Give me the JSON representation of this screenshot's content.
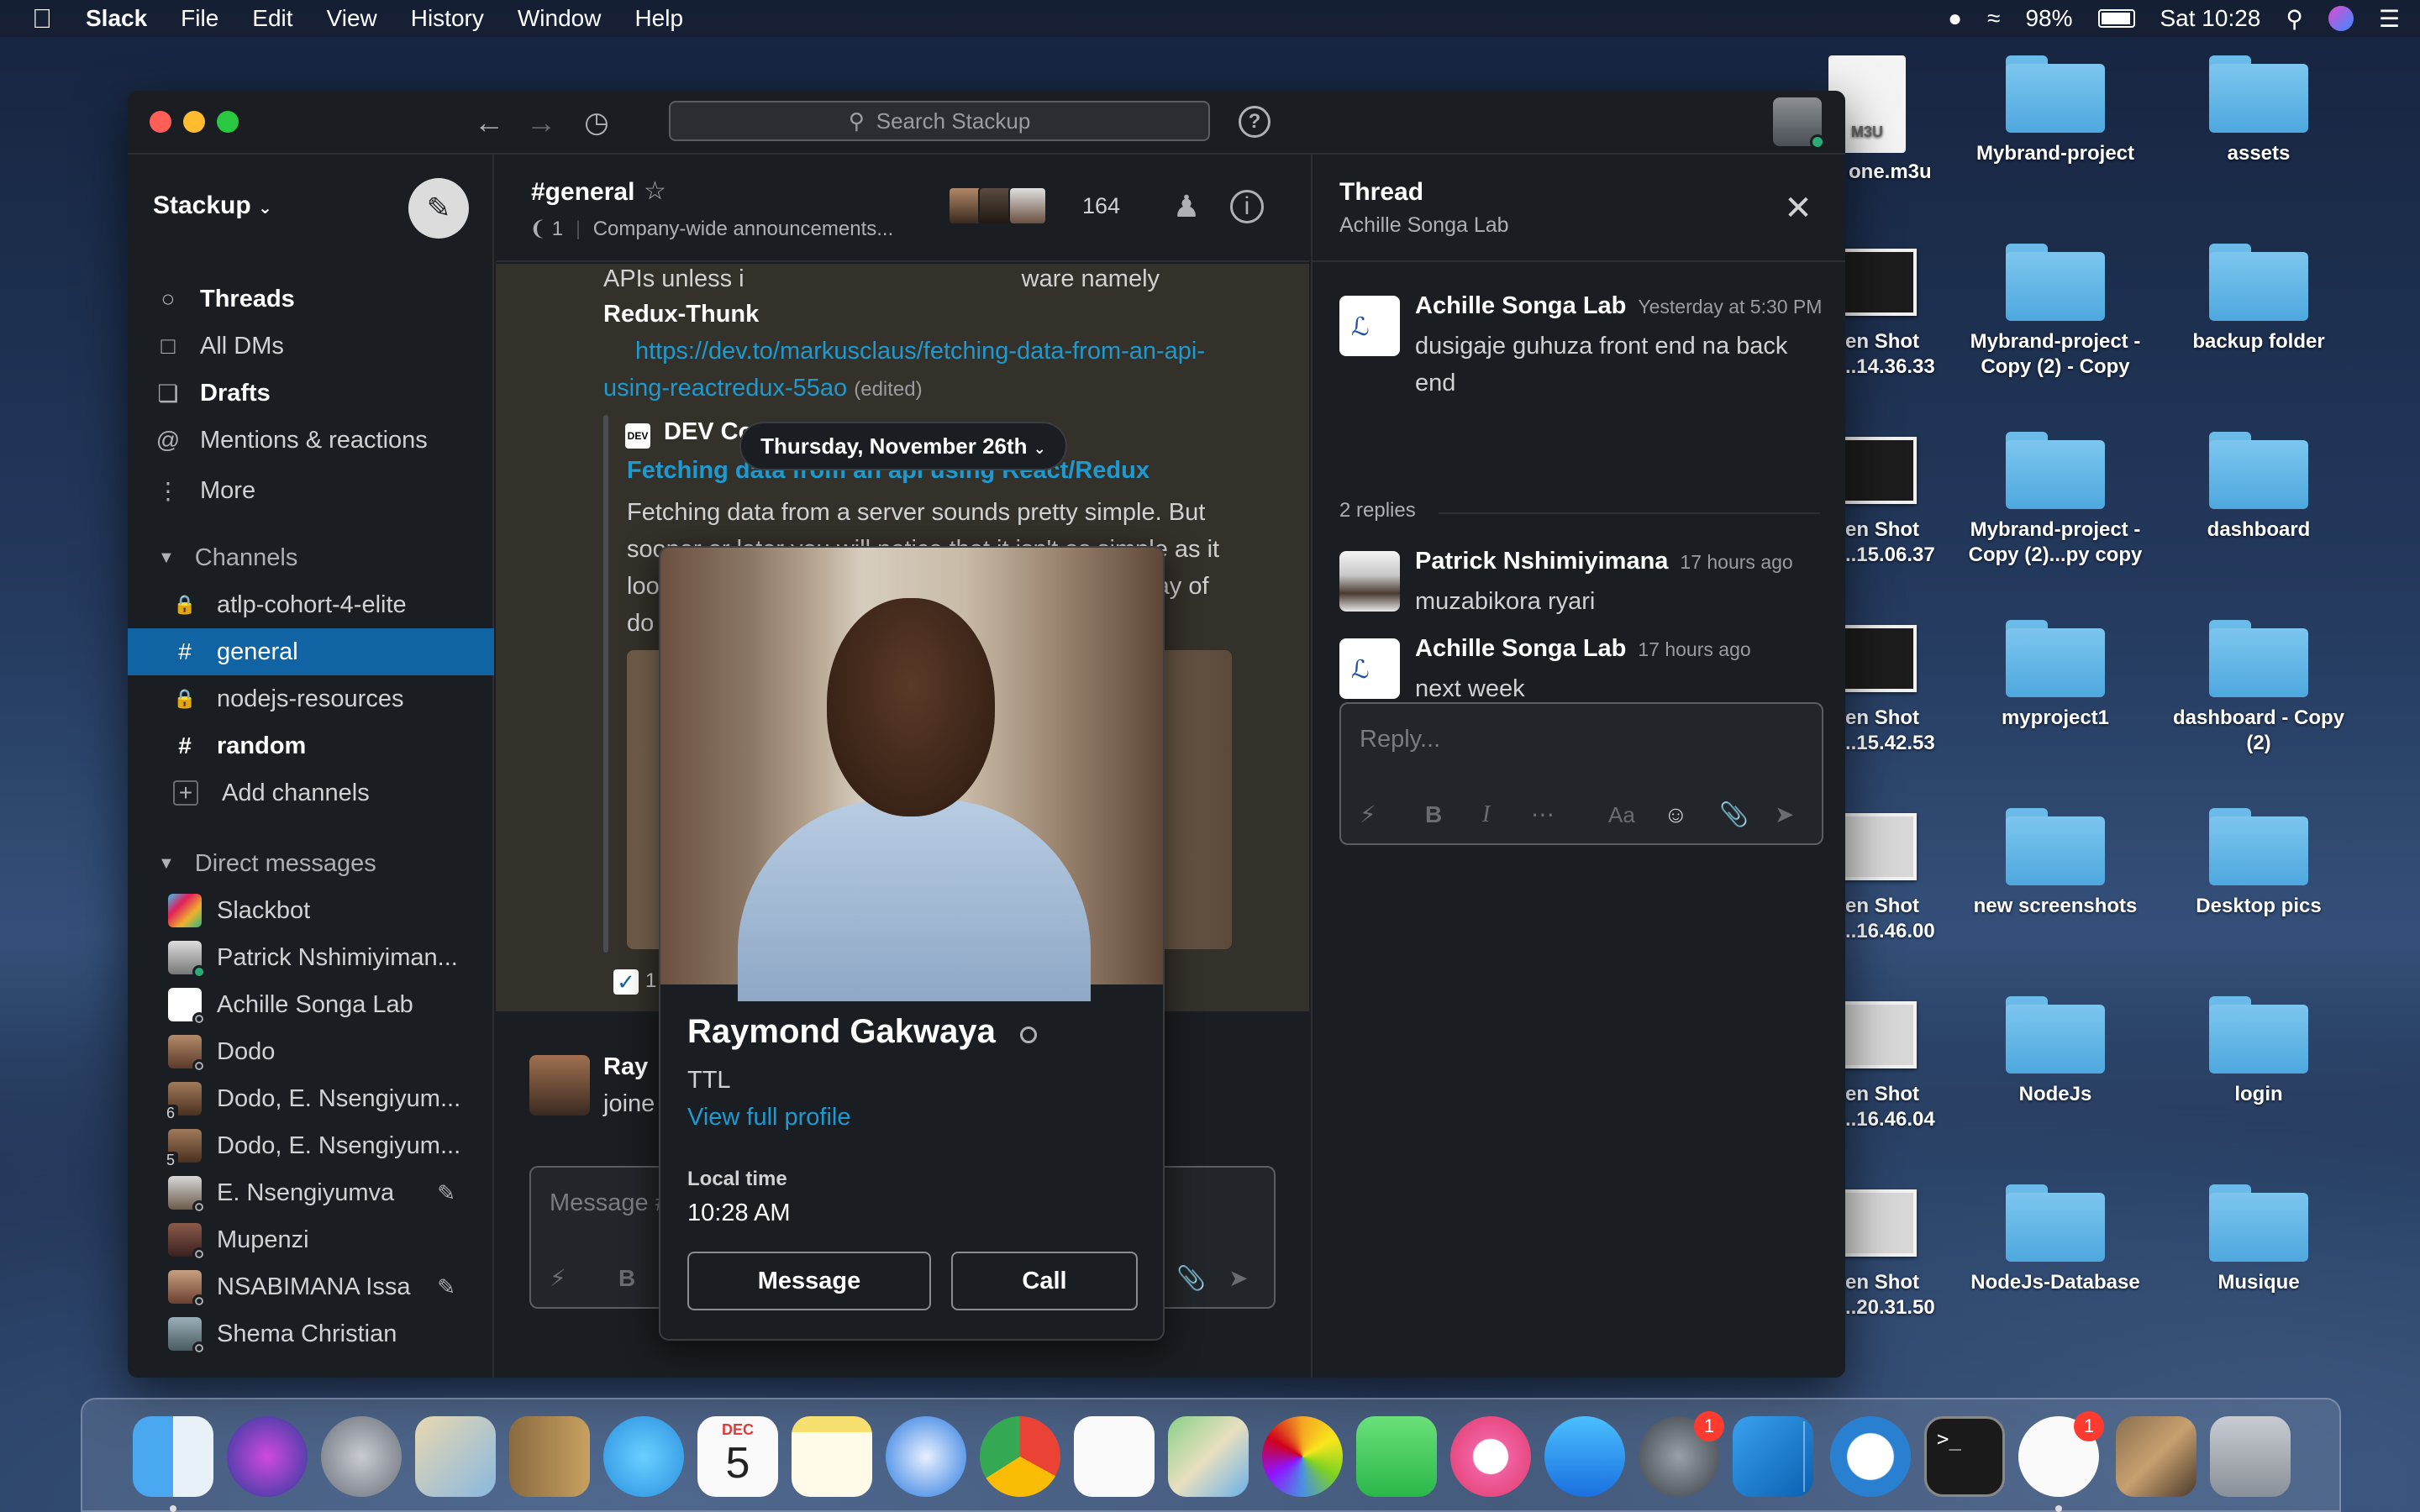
{
  "menubar": {
    "app": "Slack",
    "items": [
      "File",
      "Edit",
      "View",
      "History",
      "Window",
      "Help"
    ],
    "battery": "98%",
    "clock": "Sat 10:28"
  },
  "toolbar": {
    "search_placeholder": "Search Stackup",
    "help": "?"
  },
  "sidebar": {
    "workspace": "Stackup",
    "nav": [
      {
        "label": "Threads",
        "icon": "threads-icon",
        "bold": true
      },
      {
        "label": "All DMs",
        "icon": "dms-icon",
        "bold": false
      },
      {
        "label": "Drafts",
        "icon": "drafts-icon",
        "bold": true
      },
      {
        "label": "Mentions & reactions",
        "icon": "at-icon",
        "bold": false
      },
      {
        "label": "More",
        "icon": "more-icon",
        "bold": false
      }
    ],
    "channels_header": "Channels",
    "channels": [
      {
        "label": "atlp-cohort-4-elite",
        "icon": "lock-icon"
      },
      {
        "label": "general",
        "icon": "hash-icon",
        "active": true
      },
      {
        "label": "nodejs-resources",
        "icon": "lock-icon"
      },
      {
        "label": "random",
        "icon": "hash-icon",
        "bold": true
      }
    ],
    "add_channels": "Add channels",
    "dm_header": "Direct messages",
    "dms": [
      {
        "label": "Slackbot"
      },
      {
        "label": "Patrick Nshimiyiman..."
      },
      {
        "label": "Achille Songa Lab"
      },
      {
        "label": "Dodo"
      },
      {
        "label": "Dodo, E. Nsengiyum...",
        "count": "6"
      },
      {
        "label": "Dodo, E. Nsengiyum...",
        "count": "5"
      },
      {
        "label": "E. Nsengiyumva"
      },
      {
        "label": "Mupenzi"
      },
      {
        "label": "NSABIMANA Issa"
      },
      {
        "label": "Shema Christian"
      }
    ]
  },
  "channel": {
    "name": "#general",
    "pins": "1",
    "topic": "Company-wide announcements...",
    "member_count": "164",
    "date_divider": "Thursday, November 26th",
    "message_line1_a": "APIs unless i",
    "message_line1_b": "ware namely",
    "message_line2": "Redux-Thunk",
    "link_line1": "https://dev.to/markusclaus/fetching-data-from-an-api-",
    "link_line2": "using-reactredux-55ao",
    "edited": "(edited)",
    "unfurl_site": "DEV Community",
    "unfurl_title": "Fetching data from an api using React/Redux",
    "unfurl_desc_1": "Fetching data from a server sounds pretty simple. But",
    "unfurl_desc_2": "sooner or later you will notice that it isn't as simple as it",
    "unfurl_desc_3a": "loo",
    "unfurl_desc_3b": "way of",
    "unfurl_desc_4": "do",
    "reaction_count": "1",
    "joined_name": "Ray",
    "joined_text": "joine",
    "composer_placeholder": "Message #"
  },
  "thread": {
    "title": "Thread",
    "subtitle": "Achille Songa Lab",
    "messages": [
      {
        "name": "Achille Songa Lab",
        "time": "Yesterday at 5:30 PM",
        "text": "dusigaje guhuza front end na back end"
      },
      {
        "name": "Patrick Nshimiyimana",
        "time": "17 hours ago",
        "text": "muzabikora ryari"
      },
      {
        "name": "Achille Songa Lab",
        "time": "17 hours ago",
        "text": "next week"
      }
    ],
    "replies": "2 replies",
    "reply_placeholder": "Reply..."
  },
  "popup": {
    "name": "Raymond Gakwaya",
    "title": "TTL",
    "view_profile": "View full profile",
    "local_time_label": "Local time",
    "local_time": "10:28 AM",
    "message_btn": "Message",
    "call_btn": "Call"
  },
  "desktop": [
    {
      "label": "ylist one.m3u",
      "kind": "doc",
      "doc_label": "M3U"
    },
    {
      "label": "Mybrand-project",
      "kind": "folder"
    },
    {
      "label": "assets",
      "kind": "folder"
    },
    {
      "label": "creen Shot\n0-12...14.36.33",
      "kind": "shot"
    },
    {
      "label": "Mybrand-project -\nCopy (2) - Copy",
      "kind": "folder"
    },
    {
      "label": "backup folder",
      "kind": "folder"
    },
    {
      "label": "creen Shot\n0-12...15.06.37",
      "kind": "shot"
    },
    {
      "label": "Mybrand-project -\nCopy (2)...py copy",
      "kind": "folder"
    },
    {
      "label": "dashboard",
      "kind": "folder"
    },
    {
      "label": "creen Shot\n0-12...15.42.53",
      "kind": "shot"
    },
    {
      "label": "myproject1",
      "kind": "folder"
    },
    {
      "label": "dashboard - Copy\n(2)",
      "kind": "folder"
    },
    {
      "label": "creen Shot\n0-12...16.46.00",
      "kind": "shot-light"
    },
    {
      "label": "new screenshots",
      "kind": "folder"
    },
    {
      "label": "Desktop pics",
      "kind": "folder"
    },
    {
      "label": "creen Shot\n0-12...16.46.04",
      "kind": "shot-light"
    },
    {
      "label": "NodeJs",
      "kind": "folder"
    },
    {
      "label": "login",
      "kind": "folder"
    },
    {
      "label": "creen Shot\n0-12...20.31.50",
      "kind": "shot-light"
    },
    {
      "label": "NodeJs-Database",
      "kind": "folder"
    },
    {
      "label": "Musique",
      "kind": "folder"
    }
  ],
  "dock": {
    "apps": [
      "finder-icon",
      "siri-icon",
      "launchpad-icon",
      "mail-icon",
      "contacts-icon",
      "messages-icon",
      "calendar-icon",
      "notes-icon",
      "safari-icon",
      "chrome-icon",
      "reminders-icon",
      "maps-icon",
      "photos-icon",
      "facetime-icon",
      "itunes-icon",
      "app-store-icon",
      "system-preferences-icon",
      "vscode-icon",
      "trello-icon",
      "terminal-icon",
      "slack-icon",
      "stack-icon",
      "trash-icon"
    ],
    "calendar_month": "DEC",
    "calendar_day": "5",
    "prefs_badge": "1",
    "slack_badge": "1"
  }
}
